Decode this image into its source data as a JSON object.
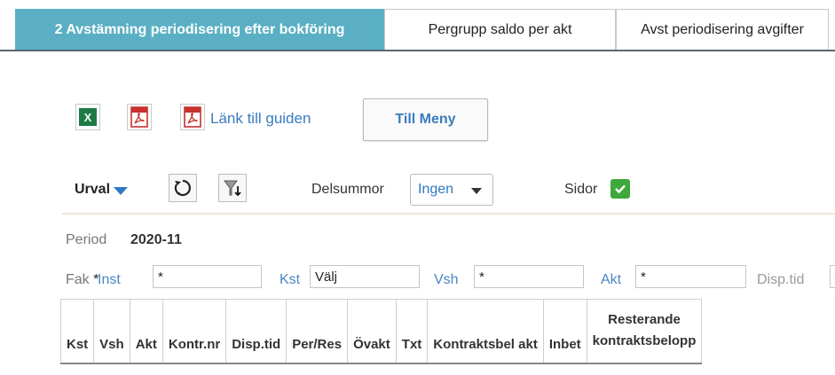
{
  "tabs": [
    {
      "label": "2 Avstämning periodisering efter bokföring",
      "active": true
    },
    {
      "label": "Pergrupp saldo per akt",
      "active": false
    },
    {
      "label": "Avst periodisering avgifter",
      "active": false
    }
  ],
  "toolbar": {
    "excel_icon": "excel-icon",
    "pdf_icon": "pdf-icon",
    "guide_link": "Länk till guiden",
    "menu_button": "Till Meny"
  },
  "selection": {
    "urval_label": "Urval",
    "delsummor_label": "Delsummor",
    "delsummor_value": "Ingen",
    "sidor_label": "Sidor",
    "sidor_checked": true
  },
  "period": {
    "label": "Period",
    "value": "2020-11"
  },
  "filters": {
    "fak_label": "Fak",
    "fak_marker": "*",
    "inst_label": "Inst",
    "inst_value": "*",
    "kst_label": "Kst",
    "kst_value": "Välj",
    "vsh_label": "Vsh",
    "vsh_value": "*",
    "akt_label": "Akt",
    "akt_value": "*",
    "disp_label": "Disp.tid",
    "disp_value": "*"
  },
  "table": {
    "columns": [
      "Kst",
      "Vsh",
      "Akt",
      "Kontr.nr",
      "Disp.tid",
      "Per/Res",
      "Övakt",
      "Txt",
      "Kontraktsbel akt",
      "Inbet"
    ],
    "last_column_line1": "Resterande",
    "last_column_line2": "kontraktsbelopp"
  },
  "colors": {
    "active_tab": "#5aafc4",
    "link": "#3a7bbf",
    "checkbox": "#3fa83c",
    "excel": "#1e7a45",
    "pdf": "#c8312e"
  }
}
